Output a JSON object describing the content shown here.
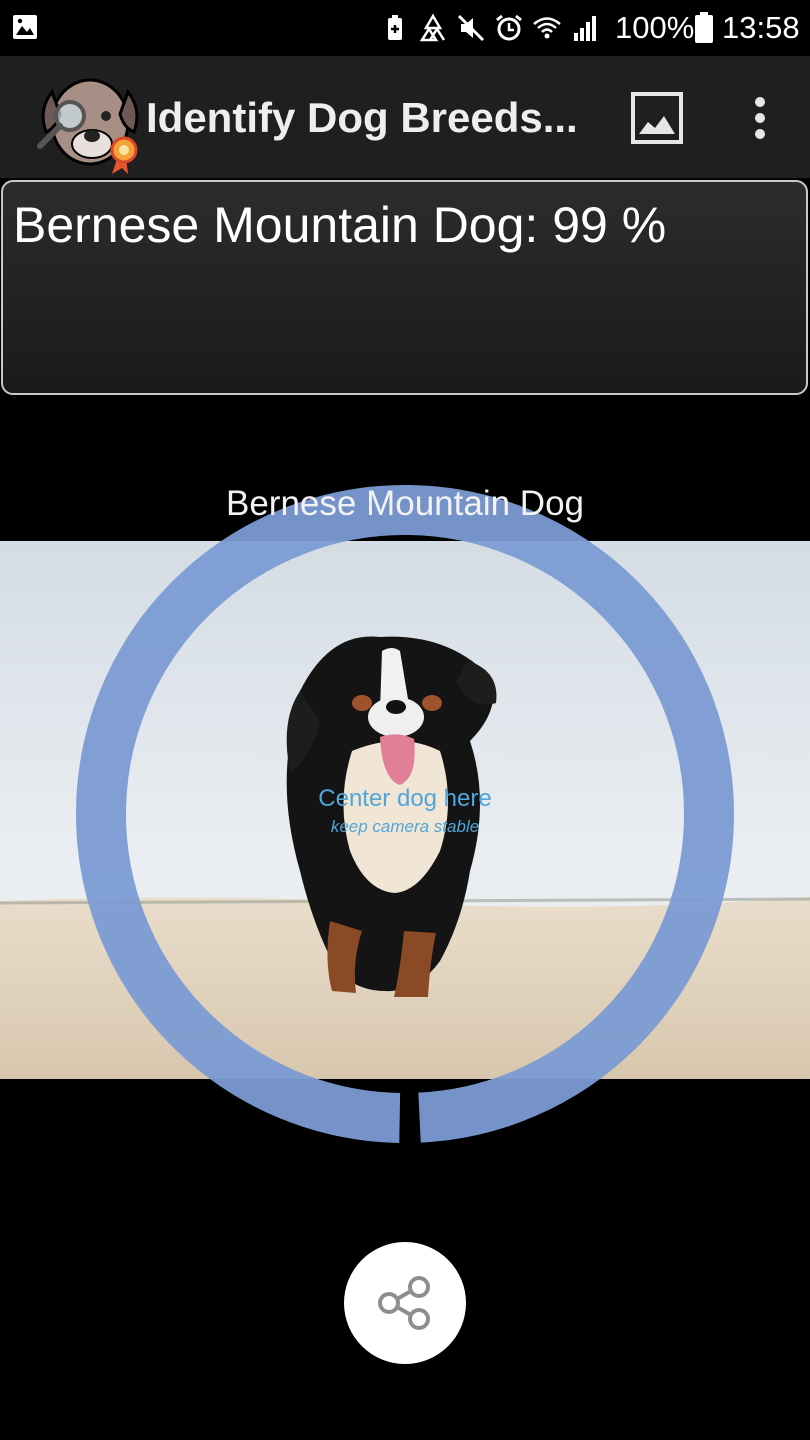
{
  "status_bar": {
    "battery_percent": "100%",
    "time": "13:58",
    "icons": [
      "image-notification-icon",
      "battery-saver-icon",
      "recycle-icon",
      "mute-icon",
      "alarm-icon",
      "wifi-icon",
      "signal-icon",
      "battery-icon"
    ]
  },
  "app_bar": {
    "title": "Identify Dog Breeds...",
    "logo_icon": "dog-magnifier-logo-icon",
    "gallery_icon": "image-gallery-icon",
    "menu_icon": "more-vertical-icon"
  },
  "result": {
    "text": "Bernese Mountain Dog: 99 %"
  },
  "camera": {
    "breed_label": "Bernese Mountain Dog",
    "center_hint": "Center dog here",
    "center_subhint": "keep camera stable",
    "ring_color": "#7b9bd3"
  },
  "share": {
    "icon": "share-icon"
  }
}
